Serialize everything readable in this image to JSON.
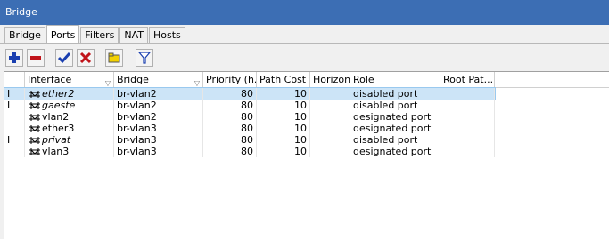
{
  "window": {
    "title": "Bridge"
  },
  "tabs": [
    {
      "label": "Bridge",
      "active": false
    },
    {
      "label": "Ports",
      "active": true
    },
    {
      "label": "Filters",
      "active": false
    },
    {
      "label": "NAT",
      "active": false
    },
    {
      "label": "Hosts",
      "active": false
    }
  ],
  "toolbar": {
    "buttons": [
      {
        "icon": "plus-icon",
        "color": "#1a3fb0"
      },
      {
        "icon": "minus-icon",
        "color": "#c0141a"
      },
      {
        "icon": "check-icon",
        "color": "#1a3fb0"
      },
      {
        "icon": "x-icon",
        "color": "#c0141a"
      },
      {
        "icon": "comment-icon",
        "color": "#f2d100"
      },
      {
        "icon": "filter-icon",
        "color": "#1a3fb0"
      }
    ]
  },
  "table": {
    "columns": [
      "Interface",
      "Bridge",
      "Priority (h...",
      "Path Cost",
      "Horizon",
      "Role",
      "Root Pat..."
    ],
    "rows": [
      {
        "flag": "I",
        "interface": "ether2",
        "italic": true,
        "bridge": "br-vlan2",
        "priority": "80",
        "path_cost": "10",
        "horizon": "",
        "role": "disabled port",
        "selected": true
      },
      {
        "flag": "I",
        "interface": "gaeste",
        "italic": true,
        "bridge": "br-vlan2",
        "priority": "80",
        "path_cost": "10",
        "horizon": "",
        "role": "disabled port",
        "selected": false
      },
      {
        "flag": "",
        "interface": "vlan2",
        "italic": false,
        "bridge": "br-vlan2",
        "priority": "80",
        "path_cost": "10",
        "horizon": "",
        "role": "designated port",
        "selected": false
      },
      {
        "flag": "",
        "interface": "ether3",
        "italic": false,
        "bridge": "br-vlan3",
        "priority": "80",
        "path_cost": "10",
        "horizon": "",
        "role": "designated port",
        "selected": false
      },
      {
        "flag": "I",
        "interface": "privat",
        "italic": true,
        "bridge": "br-vlan3",
        "priority": "80",
        "path_cost": "10",
        "horizon": "",
        "role": "disabled port",
        "selected": false
      },
      {
        "flag": "",
        "interface": "vlan3",
        "italic": false,
        "bridge": "br-vlan3",
        "priority": "80",
        "path_cost": "10",
        "horizon": "",
        "role": "designated port",
        "selected": false
      }
    ]
  }
}
